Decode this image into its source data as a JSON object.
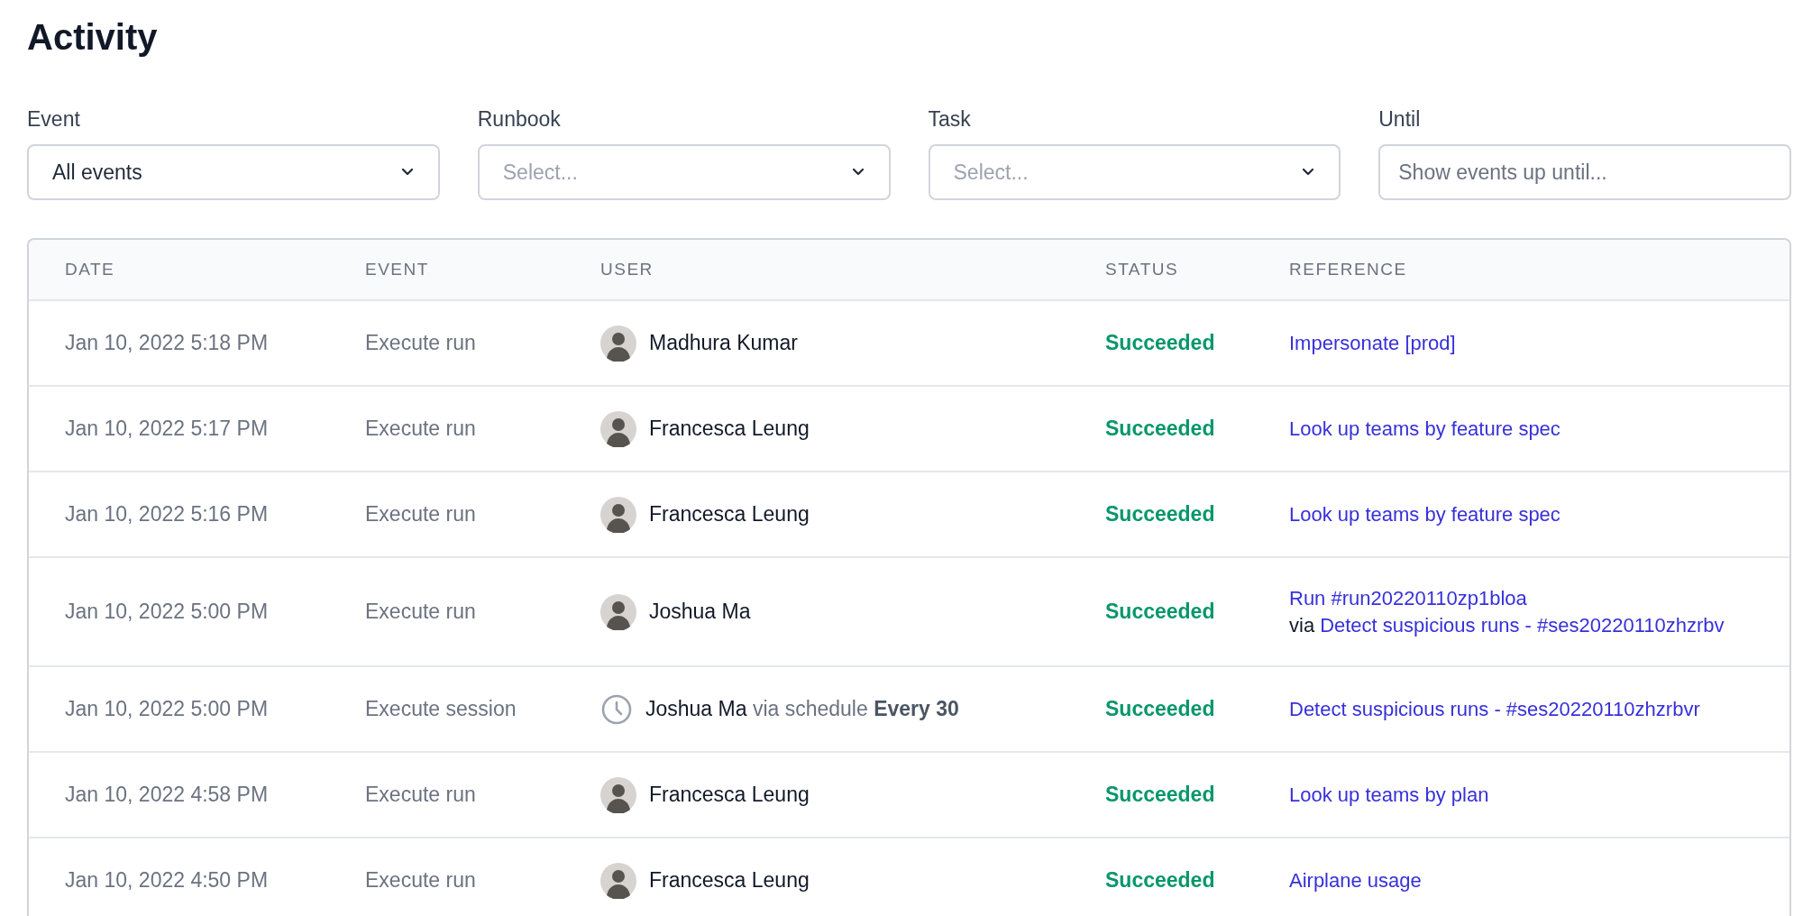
{
  "title": "Activity",
  "filters": [
    {
      "label": "Event",
      "kind": "select",
      "value": "All events"
    },
    {
      "label": "Runbook",
      "kind": "select",
      "placeholder": "Select..."
    },
    {
      "label": "Task",
      "kind": "select",
      "placeholder": "Select..."
    },
    {
      "label": "Until",
      "kind": "text",
      "placeholder": "Show events up until..."
    }
  ],
  "table": {
    "columns": [
      "DATE",
      "EVENT",
      "USER",
      "STATUS",
      "REFERENCE"
    ],
    "rows": [
      {
        "date": "Jan 10, 2022 5:18 PM",
        "event": "Execute run",
        "user": {
          "kind": "avatar",
          "name": "Madhura Kumar"
        },
        "status": "Succeeded",
        "reference": {
          "link": "Impersonate [prod]"
        }
      },
      {
        "date": "Jan 10, 2022 5:17 PM",
        "event": "Execute run",
        "user": {
          "kind": "avatar",
          "name": "Francesca Leung"
        },
        "status": "Succeeded",
        "reference": {
          "link": "Look up teams by feature spec"
        }
      },
      {
        "date": "Jan 10, 2022 5:16 PM",
        "event": "Execute run",
        "user": {
          "kind": "avatar",
          "name": "Francesca Leung"
        },
        "status": "Succeeded",
        "reference": {
          "link": "Look up teams by feature spec"
        }
      },
      {
        "date": "Jan 10, 2022 5:00 PM",
        "event": "Execute run",
        "user": {
          "kind": "avatar",
          "name": "Joshua Ma"
        },
        "status": "Succeeded",
        "reference": {
          "link": "Run #run20220110zp1bloa",
          "via": {
            "label": "via",
            "link": "Detect suspicious runs - #ses20220110zhzrbv"
          }
        }
      },
      {
        "date": "Jan 10, 2022 5:00 PM",
        "event": "Execute session",
        "user": {
          "kind": "schedule",
          "name": "Joshua Ma",
          "via": "via schedule",
          "schedule": "Every 30"
        },
        "status": "Succeeded",
        "reference": {
          "link": "Detect suspicious runs - #ses20220110zhzrbvr"
        }
      },
      {
        "date": "Jan 10, 2022 4:58 PM",
        "event": "Execute run",
        "user": {
          "kind": "avatar",
          "name": "Francesca Leung"
        },
        "status": "Succeeded",
        "reference": {
          "link": "Look up teams by plan"
        }
      },
      {
        "date": "Jan 10, 2022 4:50 PM",
        "event": "Execute run",
        "user": {
          "kind": "avatar",
          "name": "Francesca Leung"
        },
        "status": "Succeeded",
        "reference": {
          "link": "Airplane usage"
        }
      }
    ]
  }
}
